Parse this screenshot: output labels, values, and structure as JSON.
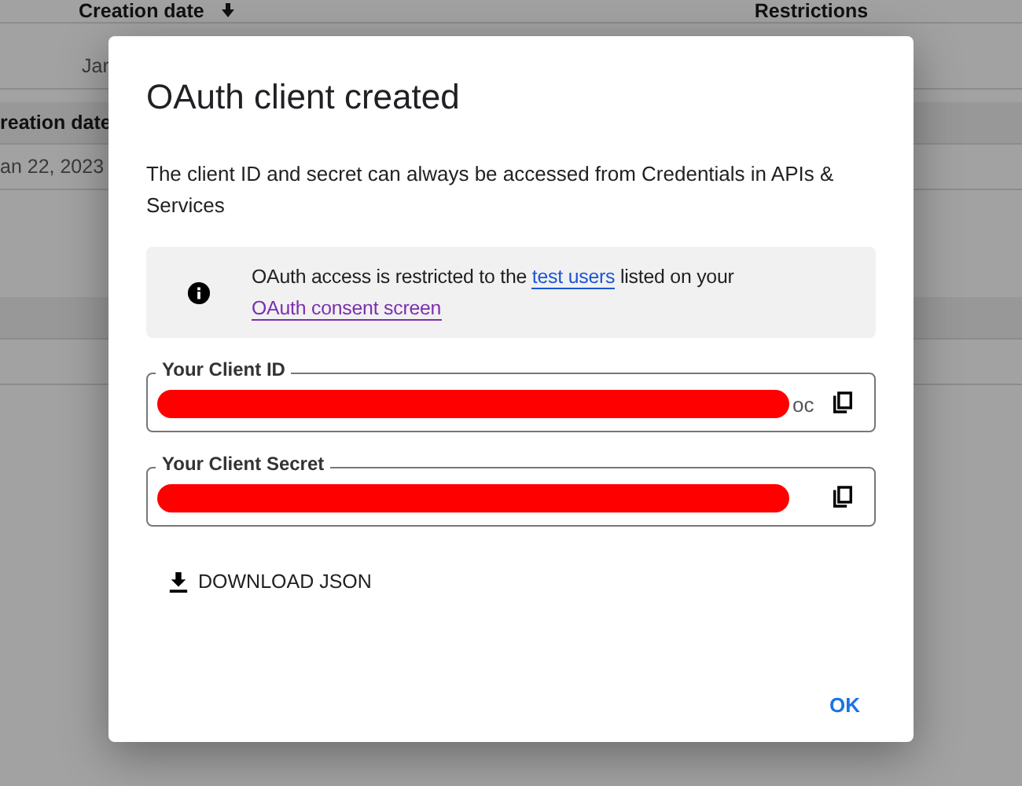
{
  "background": {
    "top_headers": [
      "Creation date",
      "Restrictions"
    ],
    "top_row_cell": "Jar",
    "second_header": "reation date",
    "second_row_cell": "an 22, 2023"
  },
  "dialog": {
    "title": "OAuth client created",
    "description": "The client ID and secret can always be accessed from Credentials in APIs & Services",
    "notice": {
      "parts": [
        {
          "kind": "text",
          "text": "OAuth access is restricted to the "
        },
        {
          "kind": "link",
          "text": "test users",
          "visited": false
        },
        {
          "kind": "text",
          "text": " listed on your "
        },
        {
          "kind": "link",
          "text": "OAuth consent screen",
          "visited": true
        }
      ]
    },
    "fields": [
      {
        "label": "Your Client ID",
        "value": "oc",
        "redacted": true
      },
      {
        "label": "Your Client Secret",
        "redacted": true
      }
    ],
    "download_button": "DOWNLOAD JSON",
    "ok_button": "OK"
  }
}
